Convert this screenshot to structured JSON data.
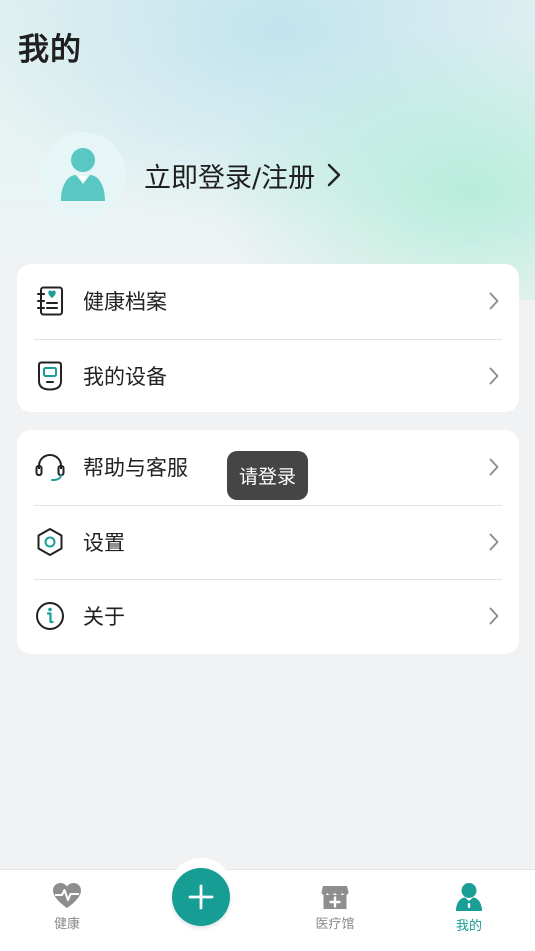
{
  "header": {
    "title": "我的"
  },
  "profile": {
    "login_text": "立即登录/注册"
  },
  "card_records": {
    "items": [
      {
        "label": "健康档案",
        "icon": "health-record-icon"
      },
      {
        "label": "我的设备",
        "icon": "device-icon"
      }
    ]
  },
  "card_support": {
    "items": [
      {
        "label": "帮助与客服",
        "icon": "headset-icon"
      },
      {
        "label": "设置",
        "icon": "settings-hexagon-icon"
      },
      {
        "label": "关于",
        "icon": "info-icon"
      }
    ]
  },
  "toast": {
    "text": "请登录"
  },
  "tabbar": {
    "tabs": [
      {
        "label": "健康",
        "icon": "heart-pulse-icon"
      },
      {
        "label": "",
        "icon": "plus-icon"
      },
      {
        "label": "医疗馆",
        "icon": "clinic-icon"
      },
      {
        "label": "我的",
        "icon": "person-icon",
        "active": true
      }
    ]
  },
  "colors": {
    "accent": "#1a9e95",
    "avatar_fill": "#5ac8c2"
  }
}
